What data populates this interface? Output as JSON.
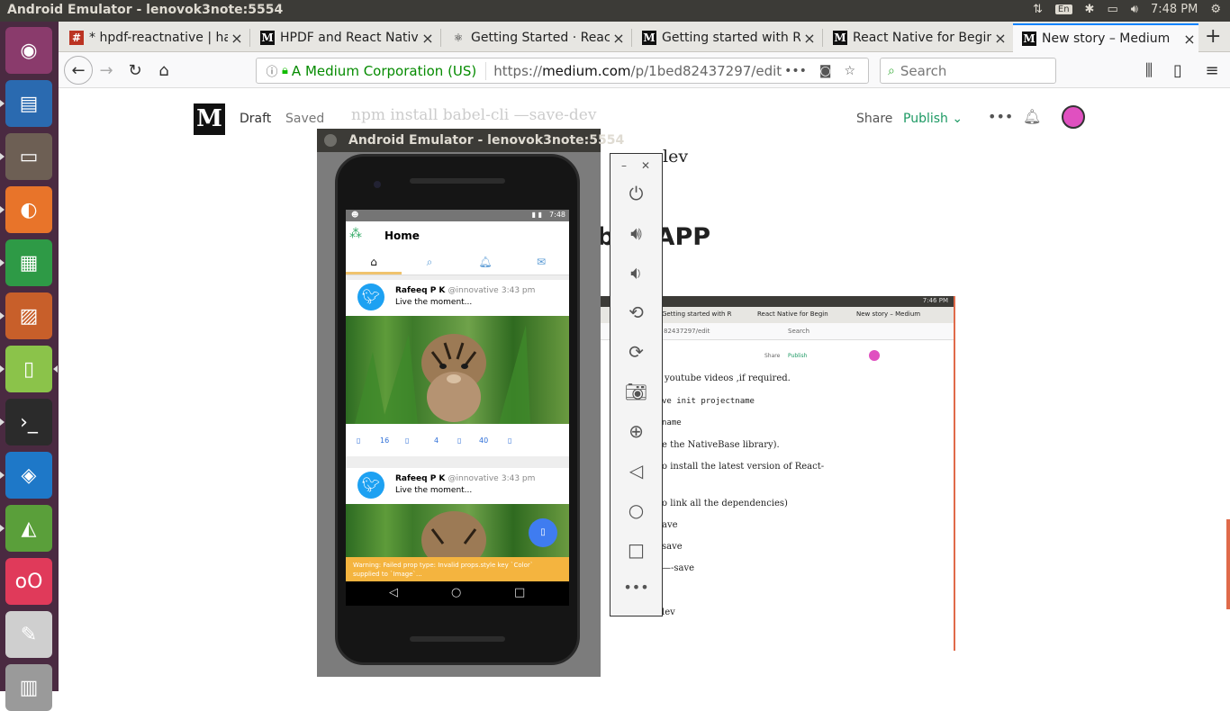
{
  "topbar": {
    "title": "Android Emulator - lenovok3note:5554",
    "keyboard": "En",
    "time": "7:48 PM"
  },
  "launcher": {
    "items": [
      {
        "name": "ubuntu-dash-icon",
        "color": "#8a3b6c"
      },
      {
        "name": "libreoffice-writer-icon",
        "color": "#2a6ab0"
      },
      {
        "name": "files-icon",
        "color": "#6d5f54"
      },
      {
        "name": "firefox-icon",
        "color": "#e8742a"
      },
      {
        "name": "libreoffice-calc-icon",
        "color": "#2e9a46"
      },
      {
        "name": "libreoffice-impress-icon",
        "color": "#c85f2a"
      },
      {
        "name": "android-emulator-icon",
        "color": "#8bc34a"
      },
      {
        "name": "terminal-icon",
        "color": "#2b2b2b"
      },
      {
        "name": "vscode-icon",
        "color": "#1e78c8"
      },
      {
        "name": "android-studio-icon",
        "color": "#5a9f3a"
      },
      {
        "name": "flickr-app-icon",
        "color": "#e03a5a"
      },
      {
        "name": "text-editor-icon",
        "color": "#cfcfcf"
      },
      {
        "name": "trash-icon",
        "color": "#9a9a9a"
      }
    ]
  },
  "tabs": [
    {
      "title": "* hpdf-reactnative | ha",
      "favicon": "#"
    },
    {
      "title": "HPDF and React Nativ",
      "favicon": "M"
    },
    {
      "title": "Getting Started · React",
      "favicon": "⚛"
    },
    {
      "title": "Getting started with R",
      "favicon": "M"
    },
    {
      "title": "React Native for Begin",
      "favicon": "M"
    },
    {
      "title": "New story – Medium",
      "favicon": "M"
    }
  ],
  "navbar": {
    "org": "A Medium Corporation (US)",
    "url_prefix": "https://",
    "url_domain": "medium.com",
    "url_path": "/p/1bed82437297/edit",
    "search_placeholder": "Search"
  },
  "medium": {
    "logo": "M",
    "draft": "Draft",
    "saved": "Saved",
    "share": "Share",
    "publish": "Publish",
    "ghost_line": "npm install babel-cli —save-dev",
    "ghost_dev": "lev",
    "heading": "bile APP"
  },
  "screenshot": {
    "tab1": "Getting started with R",
    "tab2": "React Native for Begin",
    "tab3": "New story – Medium",
    "url": "82437297/edit",
    "search": "Search",
    "share": "Share",
    "publish": "Publish",
    "time": "7:46 PM",
    "lines": [
      "youtube videos ,if required.",
      "ve init projectname",
      "name",
      "e the NativeBase library).",
      "o install the latest version of React-",
      "o link all the dependencies)",
      "ave",
      "save",
      "—-save",
      "lev"
    ]
  },
  "emulator": {
    "title": "Android Emulator - lenovok3note:5554",
    "status_time": "7:48",
    "app_title": "Home",
    "cards": [
      {
        "name": "Rafeeq P K",
        "handle": "@innovative",
        "time": "3:43 pm",
        "text": "Live the moment...",
        "stats": [
          "16",
          "4",
          "40"
        ]
      },
      {
        "name": "Rafeeq P K",
        "handle": "@innovative",
        "time": "3:43 pm",
        "text": "Live the moment..."
      }
    ],
    "warning": "Warning: Failed prop type: Invalid props.style key `Color` supplied to `Image`..."
  },
  "colors": {
    "medium_green": "#1c9963",
    "twitter_blue": "#1da1f2",
    "warning_yellow": "#f4b43f",
    "fab_blue": "#3f7cf0"
  }
}
